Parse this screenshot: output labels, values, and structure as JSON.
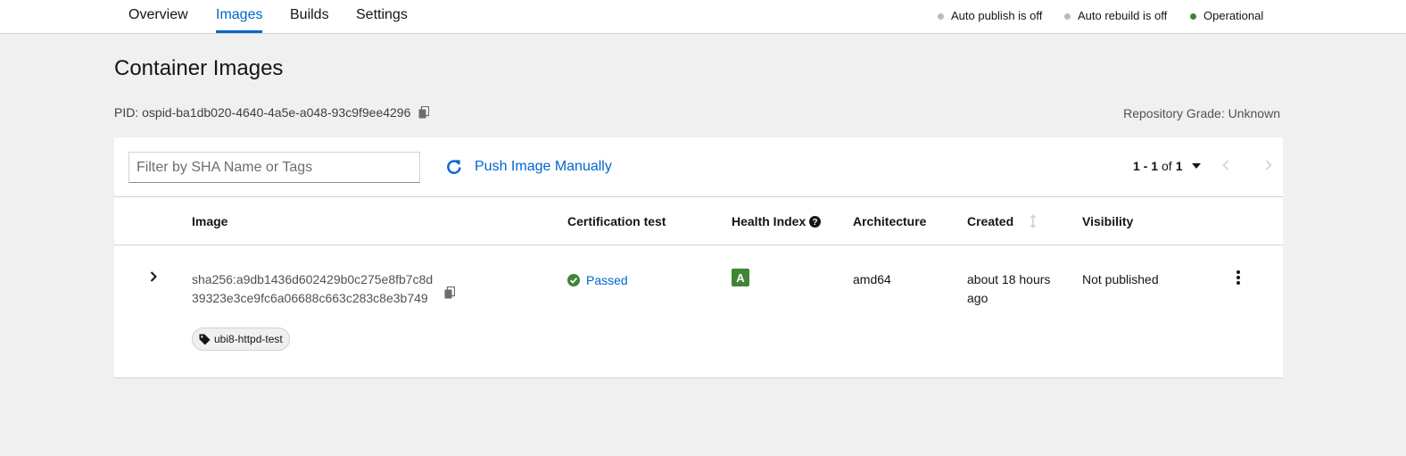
{
  "tabs": [
    {
      "label": "Overview",
      "active": false
    },
    {
      "label": "Images",
      "active": true
    },
    {
      "label": "Builds",
      "active": false
    },
    {
      "label": "Settings",
      "active": false
    }
  ],
  "statuses": [
    {
      "label": "Auto publish is off",
      "color": "#b8bbbe"
    },
    {
      "label": "Auto rebuild is off",
      "color": "#b8bbbe"
    },
    {
      "label": "Operational",
      "color": "#3e8635"
    }
  ],
  "page": {
    "title": "Container Images",
    "pid": "PID: ospid-ba1db020-4640-4a5e-a048-93c9f9ee4296",
    "grade": "Repository Grade: Unknown"
  },
  "toolbar": {
    "filter_placeholder": "Filter by SHA Name or Tags",
    "filter_value": "",
    "push_label": "Push Image Manually",
    "pagination": {
      "range": "1 - 1",
      "of": "of",
      "total": "1"
    }
  },
  "table": {
    "columns": [
      "Image",
      "Certification test",
      "Health Index",
      "Architecture",
      "Created",
      "Visibility"
    ],
    "rows": [
      {
        "sha": "sha256:a9db1436d602429b0c275e8fb7c8d39323e3ce9fc6a06688c663c283c8e3b749",
        "tag": "ubi8-httpd-test",
        "certification": "Passed",
        "health_index": "A",
        "architecture": "amd64",
        "created": "about 18 hours ago",
        "visibility": "Not published"
      }
    ]
  },
  "colors": {
    "accent": "#0066cc",
    "success": "#3e8635",
    "status_off": "#b8bbbe"
  },
  "icons": {
    "copy": "copy-icon",
    "refresh": "sync-icon",
    "caret": "caret-down-icon",
    "prev": "angle-left-icon",
    "next": "angle-right-icon",
    "help": "question-circle-icon",
    "sort": "sort-icon",
    "expand": "angle-right-icon",
    "tag": "tag-icon",
    "passed": "check-circle-icon",
    "kebab": "ellipsis-v-icon"
  }
}
